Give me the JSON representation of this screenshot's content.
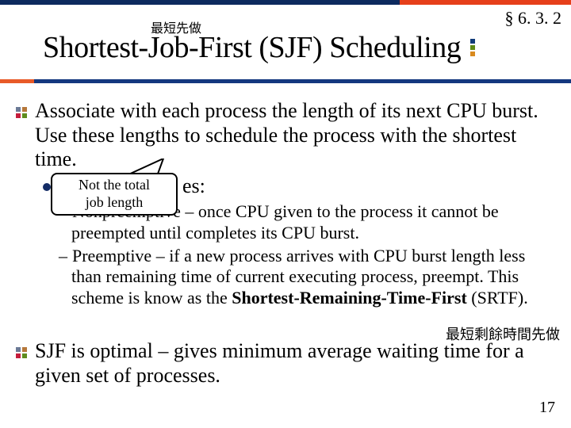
{
  "section_ref": "§ 6. 3. 2",
  "subtitle_cn": "最短先做",
  "title": "Shortest-Job-First (SJF) Scheduling",
  "bullets": {
    "b1": "Associate with each process the length of its next CPU burst.  Use these lengths to schedule the process with the shortest time.",
    "b2_tail": "es:",
    "b2a": "Nonpreemptive – once CPU given to the process it cannot be preempted until completes its CPU burst.",
    "b2b_pre": "Preemptive – if a new process arrives with CPU burst length less than remaining time of current executing process, preempt.  This scheme is know as the ",
    "b2b_bold": "Shortest-Remaining-Time-First",
    "b2b_post": " (SRTF).",
    "b3": "SJF is optimal – gives minimum average waiting time for a given set of processes."
  },
  "callout": {
    "line1": "Not the total",
    "line2": "job length"
  },
  "srtf_annot": "最短剩餘時間先做",
  "page_number": "17"
}
